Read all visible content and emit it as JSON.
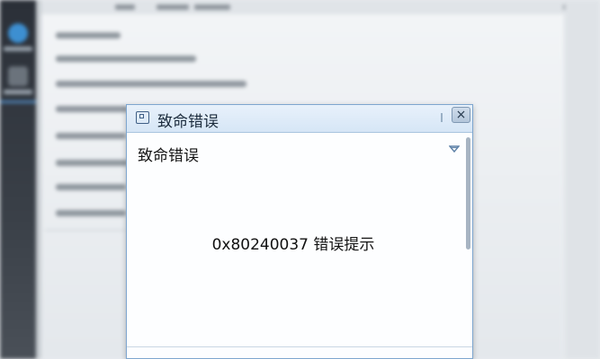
{
  "dialog": {
    "title": "致命错误",
    "header": "致命错误",
    "message": "0x80240037 错误提示",
    "close_label": "×"
  },
  "icons": {
    "title": "window-icon",
    "close": "close-icon",
    "expand": "chevron-down-icon"
  },
  "colors": {
    "titlebar": "#d6e6f6",
    "border": "#7ea6cf",
    "scrollbar": "#a7b4c2"
  }
}
